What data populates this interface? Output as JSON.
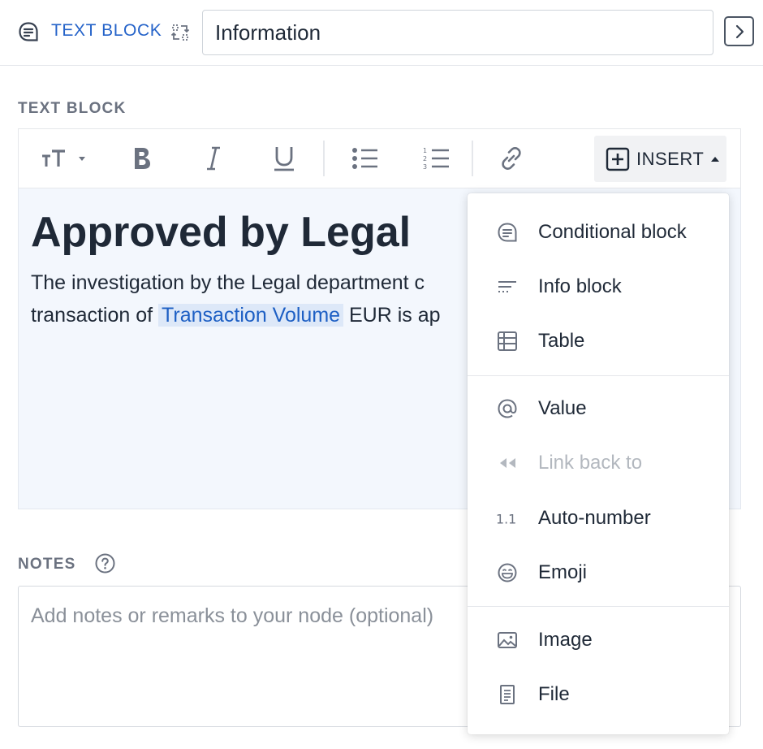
{
  "header": {
    "node_type": "TEXT BLOCK",
    "title_value": "Information"
  },
  "text_block_section": {
    "label": "TEXT BLOCK",
    "toolbar": {
      "insert_label": "INSERT"
    },
    "editor": {
      "heading": "Approved by Legal",
      "line1": "The investigation by the Legal department c",
      "line2_before": "transaction of ",
      "value_chip": "Transaction Volume",
      "line2_after": " EUR is ap"
    }
  },
  "notes_section": {
    "label": "NOTES",
    "placeholder": "Add notes or remarks to your node (optional)"
  },
  "insert_menu": {
    "groups": [
      [
        {
          "label": "Conditional block",
          "icon": "conditional-block-icon",
          "enabled": true
        },
        {
          "label": "Info block",
          "icon": "info-block-icon",
          "enabled": true
        },
        {
          "label": "Table",
          "icon": "table-icon",
          "enabled": true
        }
      ],
      [
        {
          "label": "Value",
          "icon": "at-icon",
          "enabled": true
        },
        {
          "label": "Link back to",
          "icon": "rewind-icon",
          "enabled": false
        },
        {
          "label": "Auto-number",
          "icon": "auto-number-icon",
          "enabled": true
        },
        {
          "label": "Emoji",
          "icon": "emoji-icon",
          "enabled": true
        }
      ],
      [
        {
          "label": "Image",
          "icon": "image-icon",
          "enabled": true
        },
        {
          "label": "File",
          "icon": "file-icon",
          "enabled": true
        }
      ]
    ]
  },
  "colors": {
    "accent": "#2563c9",
    "editor_background": "#f3f7fd",
    "chip_background": "#dde8f8",
    "disabled_text": "#b3b8bf"
  }
}
